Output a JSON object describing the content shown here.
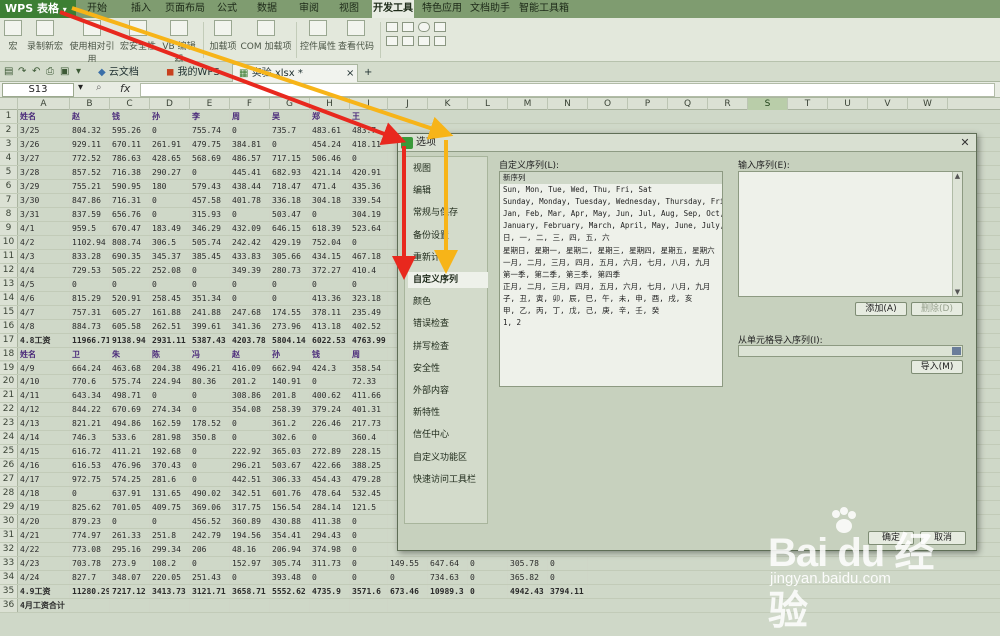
{
  "app": {
    "menu_button": "WPS 表格",
    "menu_items": [
      "开始",
      "插入",
      "页面布局",
      "公式",
      "数据",
      "审阅",
      "视图",
      "开发工具",
      "特色应用",
      "文档助手",
      "智能工具箱"
    ],
    "active_menu": "开发工具"
  },
  "toolbar": {
    "buttons": [
      "宏",
      "录制新宏",
      "使用相对引用",
      "宏安全性",
      "VB 编辑器",
      "加载项",
      "COM 加载项",
      "控件属性",
      "查看代码"
    ]
  },
  "tabs": {
    "items": [
      "云文档",
      "我的WPS",
      "实验.xlsx *"
    ],
    "new_tab": "+"
  },
  "formula_bar": {
    "name_box": "S13",
    "fx": "fx"
  },
  "columns": [
    "A",
    "B",
    "C",
    "D",
    "E",
    "F",
    "G",
    "H",
    "I",
    "J",
    "K",
    "L",
    "M",
    "N",
    "O",
    "P",
    "Q",
    "R",
    "S",
    "T",
    "U",
    "V",
    "W"
  ],
  "selected_column": "S",
  "sheet": {
    "rows": [
      {
        "n": "1",
        "cells": [
          "姓名",
          "赵",
          "钱",
          "孙",
          "李",
          "周",
          "吴",
          "郑",
          "王"
        ]
      },
      {
        "n": "2",
        "cells": [
          "3/25",
          "804.32",
          "595.26",
          "0",
          "755.74",
          "0",
          "735.7",
          "483.61",
          "483.7"
        ]
      },
      {
        "n": "3",
        "cells": [
          "3/26",
          "929.11",
          "670.11",
          "261.91",
          "479.75",
          "384.81",
          "0",
          "454.24",
          "418.11"
        ]
      },
      {
        "n": "4",
        "cells": [
          "3/27",
          "772.52",
          "786.63",
          "428.65",
          "568.69",
          "486.57",
          "717.15",
          "506.46",
          "0"
        ]
      },
      {
        "n": "5",
        "cells": [
          "3/28",
          "857.52",
          "716.38",
          "290.27",
          "0",
          "445.41",
          "682.93",
          "421.14",
          "420.91"
        ]
      },
      {
        "n": "6",
        "cells": [
          "3/29",
          "755.21",
          "590.95",
          "180",
          "579.43",
          "438.44",
          "718.47",
          "471.4",
          "435.36"
        ]
      },
      {
        "n": "7",
        "cells": [
          "3/30",
          "847.86",
          "716.31",
          "0",
          "457.58",
          "401.78",
          "336.18",
          "304.18",
          "339.54"
        ]
      },
      {
        "n": "8",
        "cells": [
          "3/31",
          "837.59",
          "656.76",
          "0",
          "315.93",
          "0",
          "503.47",
          "0",
          "304.19"
        ]
      },
      {
        "n": "9",
        "cells": [
          "4/1",
          "959.5",
          "670.47",
          "183.49",
          "346.29",
          "432.09",
          "646.15",
          "618.39",
          "523.64"
        ]
      },
      {
        "n": "10",
        "cells": [
          "4/2",
          "1102.94",
          "808.74",
          "306.5",
          "505.74",
          "242.42",
          "429.19",
          "752.04",
          "0"
        ]
      },
      {
        "n": "11",
        "cells": [
          "4/3",
          "833.28",
          "690.35",
          "345.37",
          "385.45",
          "433.83",
          "305.66",
          "434.15",
          "467.18"
        ]
      },
      {
        "n": "12",
        "cells": [
          "4/4",
          "729.53",
          "505.22",
          "252.08",
          "0",
          "349.39",
          "280.73",
          "372.27",
          "410.4"
        ]
      },
      {
        "n": "13",
        "cells": [
          "4/5",
          "0",
          "0",
          "0",
          "0",
          "0",
          "0",
          "0",
          "0"
        ]
      },
      {
        "n": "14",
        "cells": [
          "4/6",
          "815.29",
          "520.91",
          "258.45",
          "351.34",
          "0",
          "0",
          "413.36",
          "323.18"
        ]
      },
      {
        "n": "15",
        "cells": [
          "4/7",
          "757.31",
          "605.27",
          "161.88",
          "241.88",
          "247.68",
          "174.55",
          "378.11",
          "235.49"
        ]
      },
      {
        "n": "16",
        "cells": [
          "4/8",
          "884.73",
          "605.58",
          "262.51",
          "399.61",
          "341.36",
          "273.96",
          "413.18",
          "402.52"
        ]
      },
      {
        "n": "17",
        "cells": [
          "4.8工资",
          "11966.71",
          "9138.94",
          "2931.11",
          "5387.43",
          "4203.78",
          "5804.14",
          "6022.53",
          "4763.99"
        ]
      },
      {
        "n": "18",
        "cells": [
          "姓名",
          "卫",
          "朱",
          "陈",
          "冯",
          "赵",
          "孙",
          "钱",
          "周"
        ]
      },
      {
        "n": "19",
        "cells": [
          "4/9",
          "664.24",
          "463.68",
          "204.38",
          "496.21",
          "416.09",
          "662.94",
          "424.3",
          "358.54"
        ]
      },
      {
        "n": "20",
        "cells": [
          "4/10",
          "770.6",
          "575.74",
          "224.94",
          "80.36",
          "201.2",
          "140.91",
          "0",
          "72.33"
        ]
      },
      {
        "n": "21",
        "cells": [
          "4/11",
          "643.34",
          "498.71",
          "0",
          "0",
          "308.86",
          "201.8",
          "400.62",
          "411.66"
        ]
      },
      {
        "n": "22",
        "cells": [
          "4/12",
          "844.22",
          "670.69",
          "274.34",
          "0",
          "354.08",
          "258.39",
          "379.24",
          "401.31"
        ]
      },
      {
        "n": "23",
        "cells": [
          "4/13",
          "821.21",
          "494.86",
          "162.59",
          "178.52",
          "0",
          "361.2",
          "226.46",
          "217.73"
        ]
      },
      {
        "n": "24",
        "cells": [
          "4/14",
          "746.3",
          "533.6",
          "281.98",
          "350.8",
          "0",
          "302.6",
          "0",
          "360.4"
        ]
      },
      {
        "n": "25",
        "cells": [
          "4/15",
          "616.72",
          "411.21",
          "192.68",
          "0",
          "222.92",
          "365.03",
          "272.89",
          "228.15"
        ]
      },
      {
        "n": "26",
        "cells": [
          "4/16",
          "616.53",
          "476.96",
          "370.43",
          "0",
          "296.21",
          "503.67",
          "422.66",
          "388.25"
        ]
      },
      {
        "n": "27",
        "cells": [
          "4/17",
          "972.75",
          "574.25",
          "281.6",
          "0",
          "442.51",
          "306.33",
          "454.43",
          "479.28"
        ]
      },
      {
        "n": "28",
        "cells": [
          "4/18",
          "0",
          "637.91",
          "131.65",
          "490.02",
          "342.51",
          "601.76",
          "478.64",
          "532.45"
        ]
      },
      {
        "n": "29",
        "cells": [
          "4/19",
          "825.62",
          "701.05",
          "409.75",
          "369.06",
          "317.75",
          "156.54",
          "284.14",
          "121.5"
        ]
      },
      {
        "n": "30",
        "cells": [
          "4/20",
          "879.23",
          "0",
          "0",
          "456.52",
          "360.89",
          "430.88",
          "411.38",
          "0"
        ]
      },
      {
        "n": "31",
        "cells": [
          "4/21",
          "774.97",
          "261.33",
          "251.8",
          "242.79",
          "194.56",
          "354.41",
          "294.43",
          "0"
        ]
      },
      {
        "n": "32",
        "cells": [
          "4/22",
          "773.08",
          "295.16",
          "299.34",
          "206",
          "48.16",
          "206.94",
          "374.98",
          "0"
        ]
      },
      {
        "n": "33",
        "cells": [
          "4/23",
          "703.78",
          "273.9",
          "108.2",
          "0",
          "152.97",
          "305.74",
          "311.73",
          "0",
          "149.55",
          "647.64",
          "0",
          "305.78",
          "0"
        ]
      },
      {
        "n": "34",
        "cells": [
          "4/24",
          "827.7",
          "348.07",
          "220.05",
          "251.43",
          "0",
          "393.48",
          "0",
          "0",
          "0",
          "734.63",
          "0",
          "365.82",
          "0"
        ]
      },
      {
        "n": "35",
        "cells": [
          "4.9工资",
          "11280.29",
          "7217.12",
          "3413.73",
          "3121.71",
          "3658.71",
          "5552.62",
          "4735.9",
          "3571.6",
          "673.46",
          "10989.3",
          "0",
          "4942.43",
          "3794.11"
        ]
      },
      {
        "n": "36",
        "cells": [
          "4月工资合计",
          "",
          "",
          "",
          "",
          "",
          "",
          "",
          ""
        ]
      }
    ]
  },
  "dialog": {
    "title": "选项",
    "nav_items": [
      "视图",
      "编辑",
      "常规与保存",
      "备份设置",
      "重新计算",
      "自定义序列",
      "颜色",
      "错误检查",
      "拼写检查",
      "安全性",
      "外部内容",
      "新特性",
      "信任中心",
      "自定义功能区",
      "快速访问工具栏"
    ],
    "active_nav": "自定义序列",
    "custom_list_label": "自定义序列(L):",
    "custom_list_items": [
      "新序列",
      "Sun, Mon, Tue, Wed, Thu, Fri, Sat",
      "Sunday, Monday, Tuesday, Wednesday, Thursday, Friday, Saturday",
      "Jan, Feb, Mar, Apr, May, Jun, Jul, Aug, Sep, Oct, Nov, Dec",
      "January, February, March, April, May, June, July, August",
      "日, 一, 二, 三, 四, 五, 六",
      "星期日, 星期一, 星期二, 星期三, 星期四, 星期五, 星期六",
      "一月, 二月, 三月, 四月, 五月, 六月, 七月, 八月, 九月",
      "第一季, 第二季, 第三季, 第四季",
      "正月, 二月, 三月, 四月, 五月, 六月, 七月, 八月, 九月",
      "子, 丑, 寅, 卯, 辰, 巳, 午, 未, 申, 酉, 戌, 亥",
      "甲, 乙, 丙, 丁, 戊, 己, 庚, 辛, 壬, 癸",
      "1, 2"
    ],
    "input_label": "输入序列(E):",
    "add_button": "添加(A)",
    "delete_button": "删除(D)",
    "import_label": "从单元格导入序列(I):",
    "import_button": "导入(M)",
    "ok_button": "确定",
    "cancel_button": "取消"
  },
  "watermark": {
    "logo": "Bai du 经验",
    "url": "jingyan.baidu.com"
  },
  "colors": {
    "arrow_red": "#e8281e",
    "arrow_yellow": "#f7b418",
    "accent_green": "#3d7f34"
  }
}
